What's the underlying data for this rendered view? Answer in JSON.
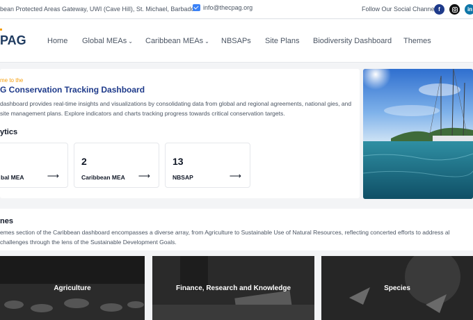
{
  "topbar": {
    "address": "bean Protected Areas Gateway, UWI (Cave Hill), St. Michael, Barbados",
    "email": "info@thecpag.org",
    "follow_label": "Follow Our Social Channels",
    "social": [
      "facebook-icon",
      "instagram-icon",
      "linkedin-icon"
    ]
  },
  "nav": {
    "logo_text": "PAG",
    "items": [
      {
        "label": "Home"
      },
      {
        "label": "Global MEAs"
      },
      {
        "label": "Caribbean MEAs"
      },
      {
        "label": "NBSAPs"
      },
      {
        "label": "Site Plans"
      },
      {
        "label": "Biodiversity Dashboard"
      },
      {
        "label": "Themes"
      }
    ]
  },
  "hero": {
    "welcome": "me to the",
    "title": "G Conservation Tracking Dashboard",
    "description": "dashboard provides real-time insights and visualizations by consolidating data from global and regional agreements, national gies, and site management plans. Explore indicators and charts tracking progress towards critical conservation targets.",
    "analytics_heading": "ytics",
    "stats": [
      {
        "value": "",
        "label": "bal MEA"
      },
      {
        "value": "2",
        "label": "Caribbean MEA"
      },
      {
        "value": "13",
        "label": "NBSAP"
      }
    ]
  },
  "themes": {
    "heading": "nes",
    "description": "emes section of the Caribbean dashboard encompasses a diverse array, from Agriculture to Sustainable Use of Natural Resources, reflecting concerted efforts to address al challenges through the lens of the Sustainable Development Goals.",
    "tiles": [
      {
        "label": "Agriculture"
      },
      {
        "label": "Finance, Research and Knowledge"
      },
      {
        "label": "Species"
      }
    ]
  },
  "colors": {
    "accent_blue": "#1e3a8a",
    "accent_orange": "#f59e0b",
    "facebook": "#1e3a8a",
    "linkedin": "#0e76a8"
  }
}
